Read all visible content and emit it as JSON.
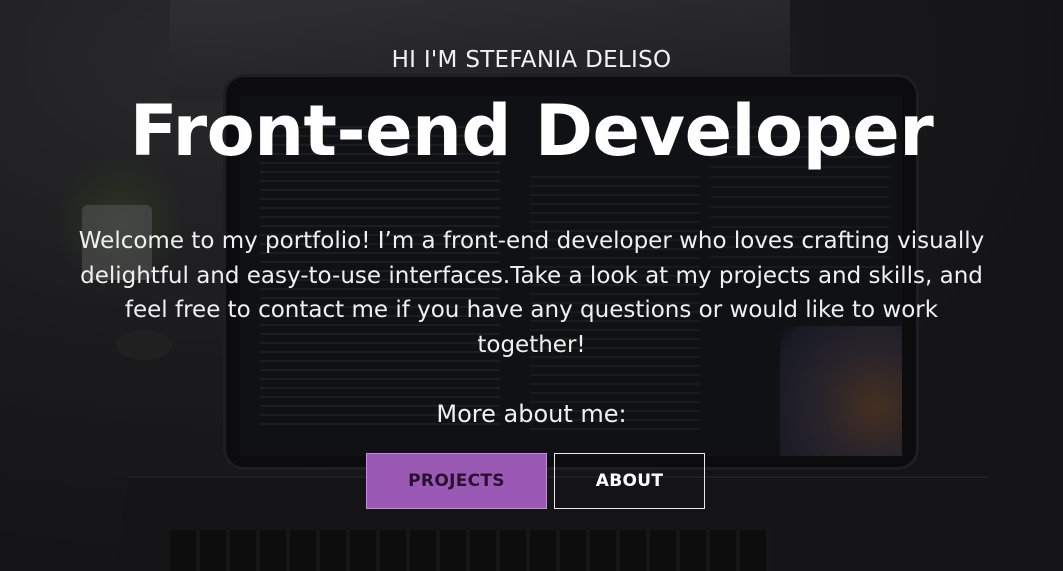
{
  "hero": {
    "eyebrow": "HI I'M STEFANIA DELISO",
    "title": "Front-end Developer",
    "intro": "Welcome to my portfolio! I’m a front-end developer who loves crafting visually delightful and easy-to-use interfaces.Take a look at my projects and skills, and feel free to contact me if you have any questions or would like to work together!",
    "more_label": "More about me:",
    "buttons": {
      "projects": "PROJECTS",
      "about": "ABOUT"
    }
  },
  "colors": {
    "accent": "#9b59b6",
    "background": "#1b1b1d",
    "text": "#ffffff"
  }
}
